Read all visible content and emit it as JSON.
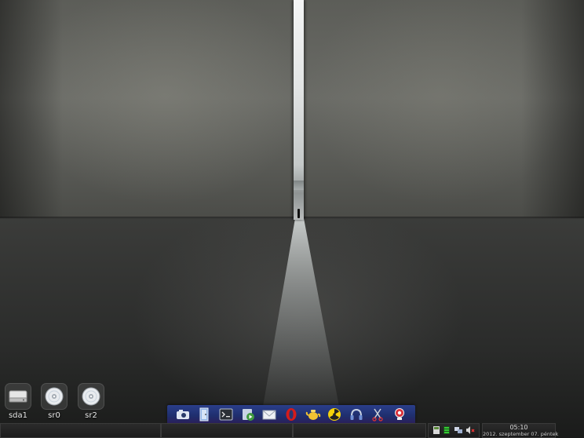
{
  "desktop": {
    "icons": [
      {
        "label": "sda1",
        "icon": "hard-drive-icon"
      },
      {
        "label": "sr0",
        "icon": "optical-disc-icon"
      },
      {
        "label": "sr2",
        "icon": "optical-disc-icon"
      }
    ]
  },
  "dock": {
    "items": [
      {
        "name": "screenshot-camera-icon"
      },
      {
        "name": "file-manager-door-icon"
      },
      {
        "name": "terminal-icon"
      },
      {
        "name": "media-player-icon"
      },
      {
        "name": "mail-envelope-icon"
      },
      {
        "name": "opera-browser-icon"
      },
      {
        "name": "teapot-icon"
      },
      {
        "name": "radiation-icon"
      },
      {
        "name": "headphones-icon"
      },
      {
        "name": "scissors-tool-icon"
      },
      {
        "name": "webcam-icon"
      }
    ]
  },
  "tray": {
    "icons": [
      "window-manager-icon",
      "battery-green-icon",
      "network-icon",
      "volume-muted-icon"
    ]
  },
  "clock": {
    "time": "05:10",
    "date": "2012. szeptember 07. péntek"
  },
  "colors": {
    "dock_bg": "#1f2f6e",
    "panel_bg": "#1c1c1c",
    "battery": "#33cc33"
  }
}
